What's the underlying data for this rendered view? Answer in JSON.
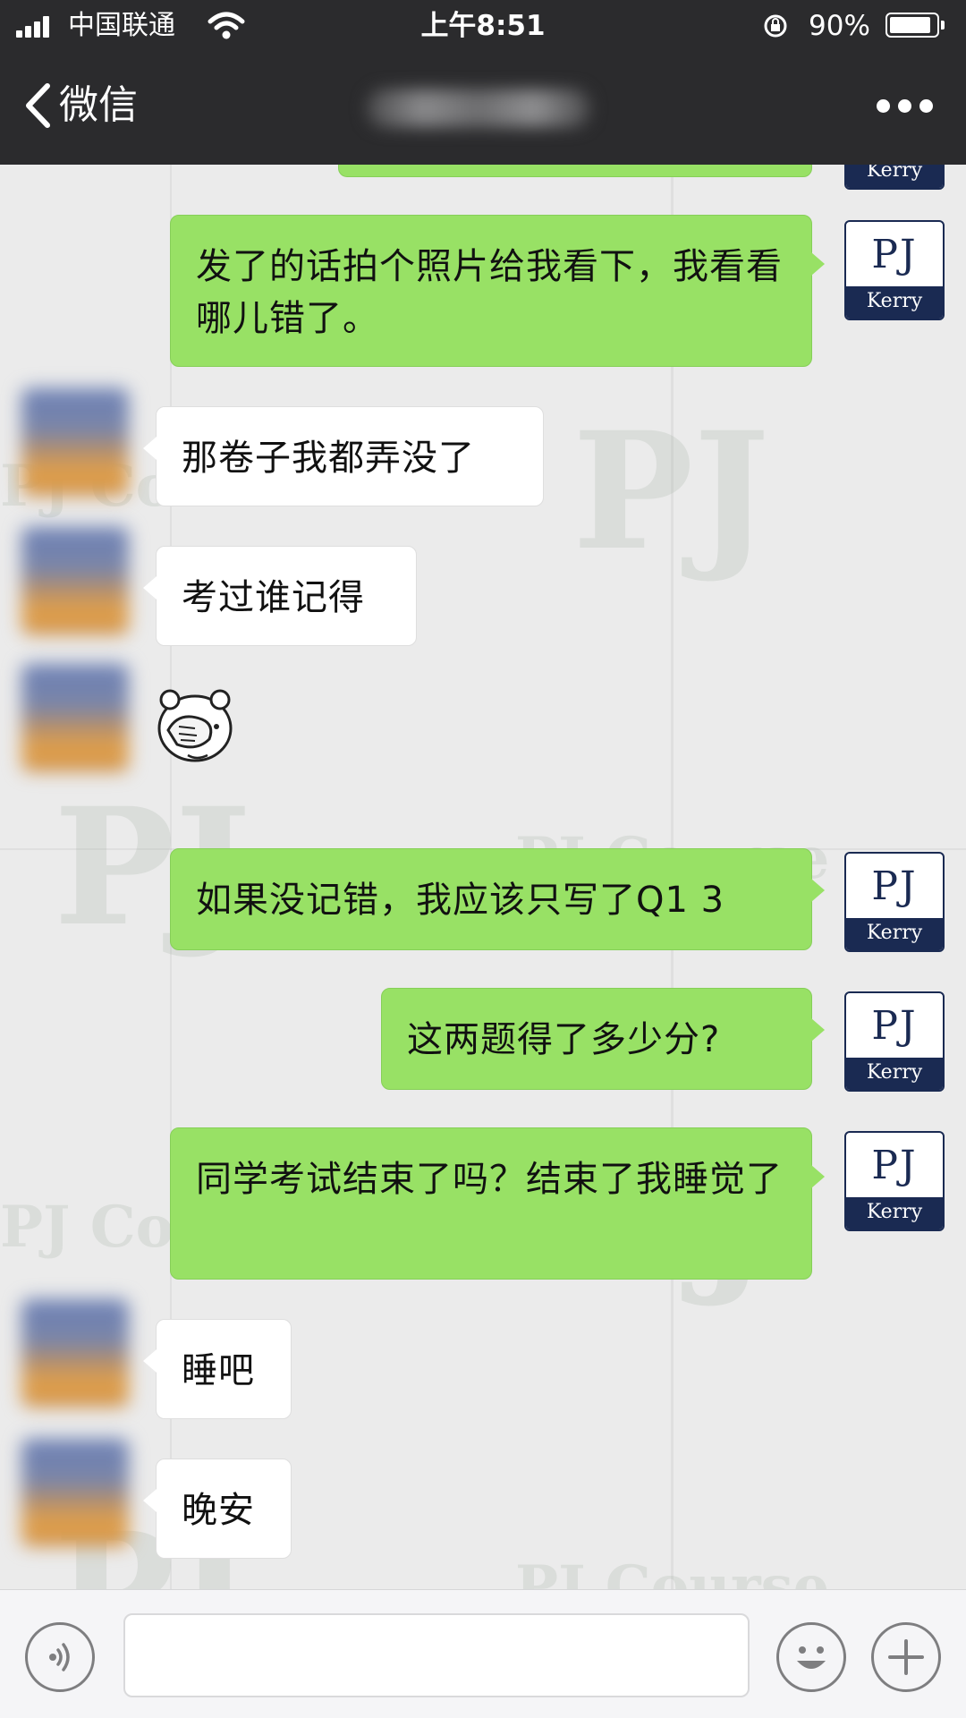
{
  "status_bar": {
    "carrier": "中国联通",
    "time": "上午8:51",
    "battery_percent": "90%",
    "battery_level": 0.9
  },
  "nav": {
    "back_label": "微信",
    "title": ""
  },
  "watermark": {
    "short": "PJ",
    "long": "PJ Course"
  },
  "messages": [
    {
      "direction": "out",
      "sender": "PJ Kerry",
      "text": "发了的话拍个照片给我看下，我看看哪儿错了。"
    },
    {
      "direction": "in",
      "text": "那卷子我都弄没了"
    },
    {
      "direction": "in",
      "text": "考过谁记得"
    },
    {
      "direction": "in",
      "type": "sticker",
      "sticker": "facepalm-bear"
    },
    {
      "direction": "out",
      "sender": "PJ Kerry",
      "text": "如果没记错，我应该只写了Q1 3"
    },
    {
      "direction": "out",
      "sender": "PJ Kerry",
      "text": "这两题得了多少分?"
    },
    {
      "direction": "out",
      "sender": "PJ Kerry",
      "text": "同学考试结束了吗？结束了我睡觉了"
    },
    {
      "direction": "in",
      "text": "睡吧"
    },
    {
      "direction": "in",
      "text": "晚安"
    }
  ],
  "avatar_me": {
    "initials": "PJ",
    "name": "Kerry"
  },
  "input_bar": {
    "placeholder": "",
    "value": ""
  },
  "icons": {
    "back": "chevron-left-icon",
    "more": "more-dots-icon",
    "voice": "voice-icon",
    "emoji": "emoji-icon",
    "plus": "plus-icon"
  }
}
